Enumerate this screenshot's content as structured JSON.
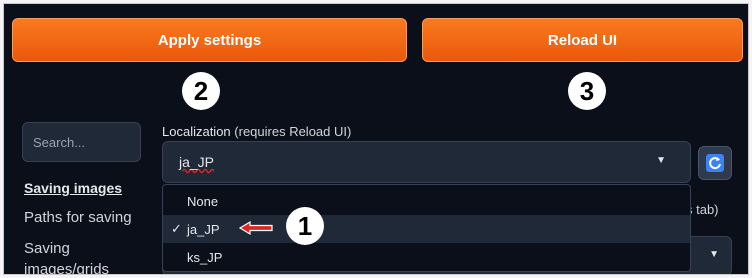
{
  "buttons": {
    "apply": "Apply settings",
    "reload": "Reload UI"
  },
  "markers": [
    "2",
    "3",
    "1"
  ],
  "sidebar": {
    "search_placeholder": "Search...",
    "items": [
      {
        "label": "Saving images",
        "active": true
      },
      {
        "label": "Paths for saving",
        "active": false
      },
      {
        "label": "Saving",
        "active": false
      },
      {
        "label": "images/grids",
        "active": false
      }
    ]
  },
  "setting": {
    "label": "Localization",
    "note": "(requires Reload UI)",
    "selected_value": "ja_JP",
    "options": [
      "None",
      "ja_JP",
      "ks_JP"
    ],
    "checked_option": "ja_JP",
    "check_mark": "✓"
  },
  "partial_text": "s tab)",
  "colors": {
    "accent": "#ea580c",
    "background": "#0b0f19",
    "panel": "#1f2937",
    "arrow": "#dc2626"
  },
  "icons": {
    "caret": "caret-down-icon",
    "refresh": "refresh-icon",
    "arrow": "left-arrow-icon"
  }
}
